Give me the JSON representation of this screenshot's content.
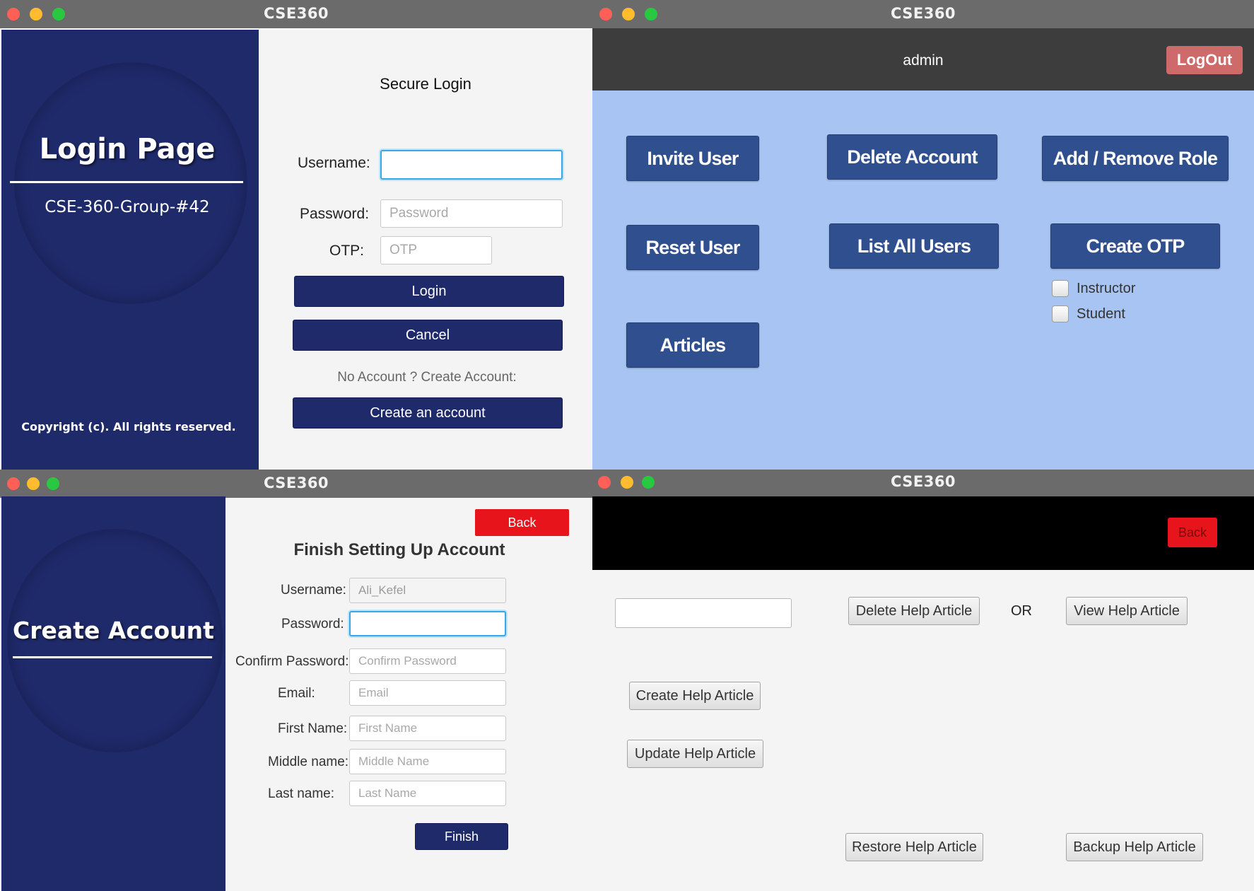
{
  "login_window": {
    "title": "CSE360",
    "side_title": "Login Page",
    "side_subtitle": "CSE-360-Group-#42",
    "copyright": "Copyright (c). All rights reserved.",
    "heading": "Secure Login",
    "username_label": "Username:",
    "username_value": "",
    "password_label": "Password:",
    "password_placeholder": "Password",
    "otp_label": "OTP:",
    "otp_placeholder": "OTP",
    "login_button": "Login",
    "cancel_button": "Cancel",
    "no_account_text": "No Account ? Create Account:",
    "create_account_button": "Create an account"
  },
  "admin_window": {
    "title": "CSE360",
    "user_label": "admin",
    "logout_button": "LogOut",
    "buttons": {
      "invite_user": "Invite User",
      "delete_account": "Delete Account",
      "add_remove_role": "Add / Remove Role",
      "reset_user": "Reset User",
      "list_all_users": "List All Users",
      "create_otp": "Create OTP",
      "articles": "Articles"
    },
    "roles": [
      {
        "label": "Instructor",
        "checked": false
      },
      {
        "label": "Student",
        "checked": false
      }
    ]
  },
  "create_account_window": {
    "title": "CSE360",
    "side_title": "Create Account",
    "back_button": "Back",
    "heading": "Finish Setting Up Account",
    "username_label": "Username:",
    "username_value": "Ali_Kefel",
    "password_label": "Password:",
    "password_value": "",
    "confirm_password_label": "Confirm Password:",
    "confirm_password_placeholder": "Confirm Password",
    "email_label": "Email:",
    "email_placeholder": "Email",
    "first_name_label": "First Name:",
    "first_name_placeholder": "First Name",
    "middle_name_label": "Middle name:",
    "middle_name_placeholder": "Middle Name",
    "last_name_label": "Last name:",
    "last_name_placeholder": "Last Name",
    "finish_button": "Finish"
  },
  "articles_window": {
    "title": "CSE360",
    "back_button": "Back",
    "search_value": "",
    "delete_button": "Delete Help Article",
    "or_text": "OR",
    "view_button": "View Help Article",
    "create_button": "Create Help Article",
    "update_button": "Update Help Article",
    "restore_button": "Restore Help Article",
    "backup_button": "Backup Help Article"
  },
  "colors": {
    "navy": "#1f2a6b",
    "admin_blue": "#a8c4f2",
    "button_blue": "#2f4f8f",
    "logout_red": "#cf6a6a",
    "back_red": "#e8141c"
  }
}
